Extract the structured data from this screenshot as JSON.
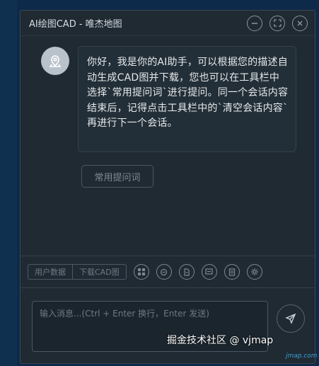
{
  "window": {
    "title": "AI绘图CAD - 唯杰地图",
    "buttons": [
      "minimize-icon",
      "fullscreen-icon",
      "close-icon"
    ]
  },
  "chat": {
    "assistant_avatar_icon": "map-pin-icon",
    "messages": [
      {
        "role": "assistant",
        "text": "你好，我是你的AI助手，可以根据您的描述自动生成CAD图并下载，您也可以在工具栏中选择`常用提问词`进行提问。同一个会话内容结束后，记得点击工具栏中的`清空会话内容`再进行下一个会话。"
      }
    ],
    "quick_button_label": "常用提问词"
  },
  "toolbar": {
    "user_data_label": "用户数据",
    "download_cad_label": "下载CAD图",
    "icons": [
      "grid-icon",
      "chat-icon",
      "document-icon",
      "message-icon",
      "list-icon",
      "settings-icon"
    ]
  },
  "composer": {
    "placeholder": "输入消息...(Ctrl + Enter 换行，Enter 发送)",
    "value": "",
    "send_icon": "send-icon"
  },
  "overlay": {
    "watermark": "掘金技术社区 @ vjmap",
    "corner_text": "jmap.com"
  },
  "colors": {
    "page_bg": "#0e2a4a",
    "window_bg": "#1f2a33",
    "text": "#e6e9ec",
    "muted": "#7f8a94"
  }
}
